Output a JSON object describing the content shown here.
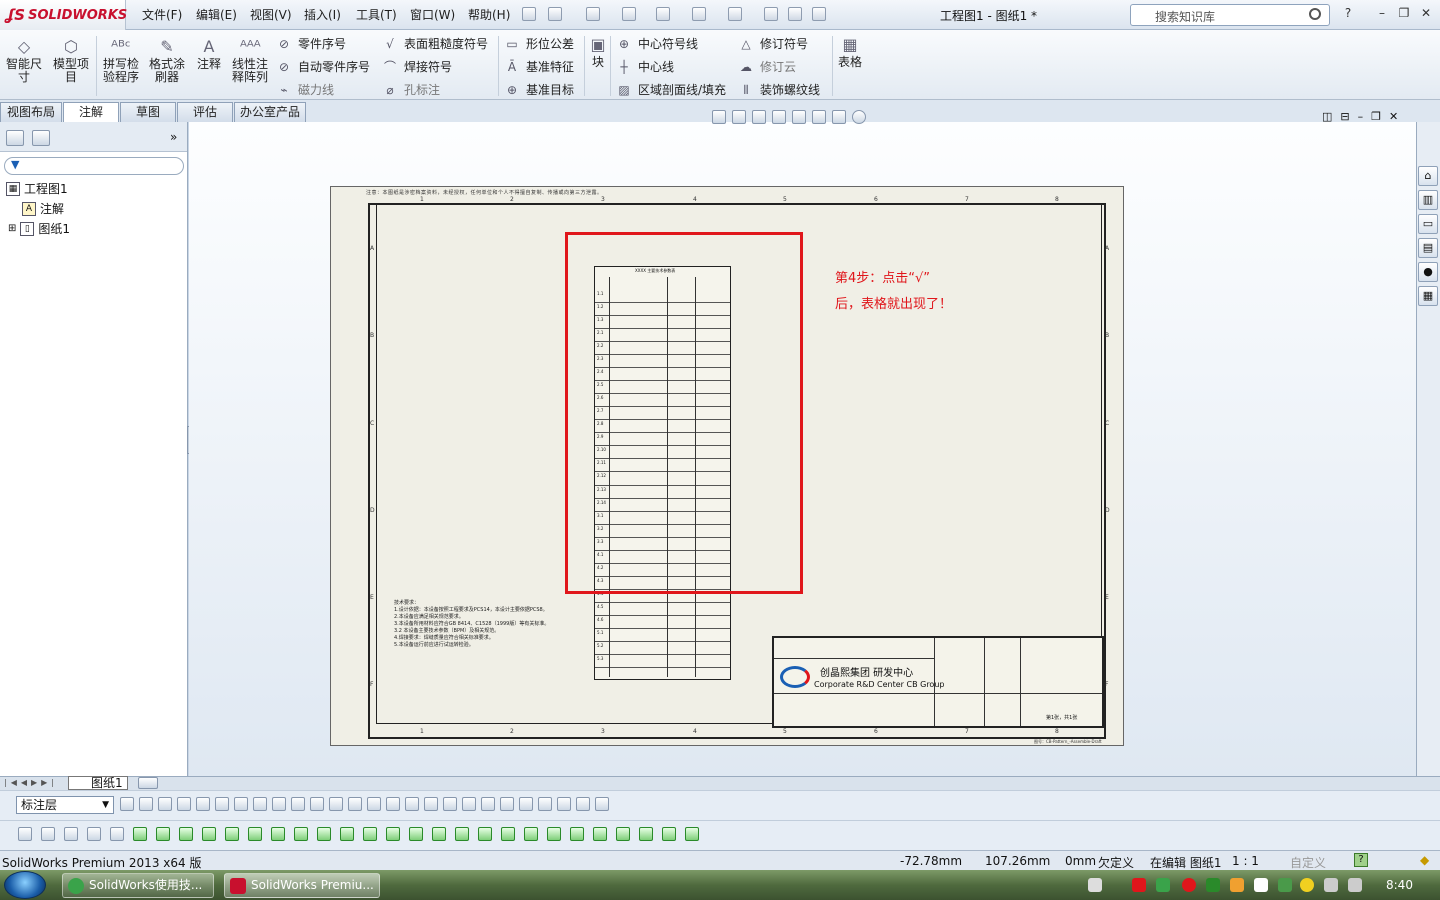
{
  "app": {
    "logo": "SOLIDWORKS",
    "doc_title": "工程图1 - 图纸1 *",
    "search_placeholder": "搜索知识库"
  },
  "menu": [
    "文件(F)",
    "编辑(E)",
    "视图(V)",
    "插入(I)",
    "工具(T)",
    "窗口(W)",
    "帮助(H)"
  ],
  "ribbon": {
    "big": [
      {
        "label": "智能尺\n寸",
        "icon": "smart-dimension-icon"
      },
      {
        "label": "模型项\n目",
        "icon": "model-items-icon"
      },
      {
        "label": "拼写检\n验程序",
        "icon": "spell-check-icon"
      },
      {
        "label": "格式涂\n刷器",
        "icon": "format-painter-icon"
      },
      {
        "label": "注释",
        "icon": "note-icon"
      },
      {
        "label": "线性注\n释阵列",
        "icon": "linear-note-pattern-icon"
      }
    ],
    "col1": [
      "零件序号",
      "自动零件序号",
      "磁力线"
    ],
    "col2": [
      "表面粗糙度符号",
      "焊接符号",
      "孔标注"
    ],
    "col3": [
      "形位公差",
      "基准特征",
      "基准目标"
    ],
    "block": "块",
    "col4": [
      "中心符号线",
      "中心线",
      "区域剖面线/填充"
    ],
    "col5": [
      "修订符号",
      "修订云",
      "装饰螺纹线"
    ],
    "table": "表格"
  },
  "tabs": [
    "视图布局",
    "注解",
    "草图",
    "评估",
    "办公室产品"
  ],
  "active_tab": "注解",
  "tree": {
    "root": "工程图1",
    "items": [
      "注解",
      "图纸1"
    ]
  },
  "sheet": {
    "top_note": "注意：本图纸是涉密档案资料，未经授权，任何单位和个人不得擅自复制、传播或向第三方泄露。",
    "col_labels": [
      "1",
      "2",
      "3",
      "4",
      "5",
      "6",
      "7",
      "8"
    ],
    "row_labels": [
      "A",
      "B",
      "C",
      "D",
      "E",
      "F"
    ],
    "bom_title": "XXXX 主要技术参数表",
    "bom_rows": [
      "1.1",
      "1.2",
      "1.3",
      "2.1",
      "2.2",
      "2.3",
      "2.4",
      "2.5",
      "2.6",
      "2.7",
      "2.8",
      "2.9",
      "2.10",
      "2.11",
      "2.12",
      "2.13",
      "2.14",
      "3.1",
      "3.2",
      "3.3",
      "4.1",
      "4.2",
      "4.3",
      "4.4",
      "4.5",
      "4.6",
      "5.1",
      "5.2",
      "5.3"
    ],
    "notes": [
      "技术要求：",
      "1.设计依据：本设备按照工程要求及PCS14，本设计主要依据PCS8。",
      "2.本设备应满足相关规范要求。",
      "3.本设备所用材料应符合GB 8414、C1528（1999版）等有关标准。",
      "3.2 本设备主要技术参数（BPM）及相关规范。",
      "4.焊接要求：焊缝质量应符合相关标准要求。",
      "5.本设备运行前应进行试运转检验。"
    ],
    "company": "创晶熙集团 研发中心",
    "company_en": "Corporate R&D Center CB Group",
    "sheet_count": "第1张，共1张",
    "bottom_right": "图号：CB-Pattern_-Assemble-Draft"
  },
  "annotation": {
    "line1": "第4步：点击“√”",
    "line2": "后，表格就出现了！"
  },
  "sheet_tab": "图纸1",
  "layer": "标注层",
  "status": {
    "app": "SolidWorks Premium 2013 x64 版",
    "x": "-72.78mm",
    "y": "107.26mm",
    "z": "0mm",
    "state": "欠定义",
    "editing": "在编辑 图纸1",
    "scale": "1 : 1",
    "custom": "自定义"
  },
  "taskbar": {
    "tasks": [
      "SolidWorks使用技...",
      "SolidWorks Premiu..."
    ],
    "time": "8:40"
  }
}
